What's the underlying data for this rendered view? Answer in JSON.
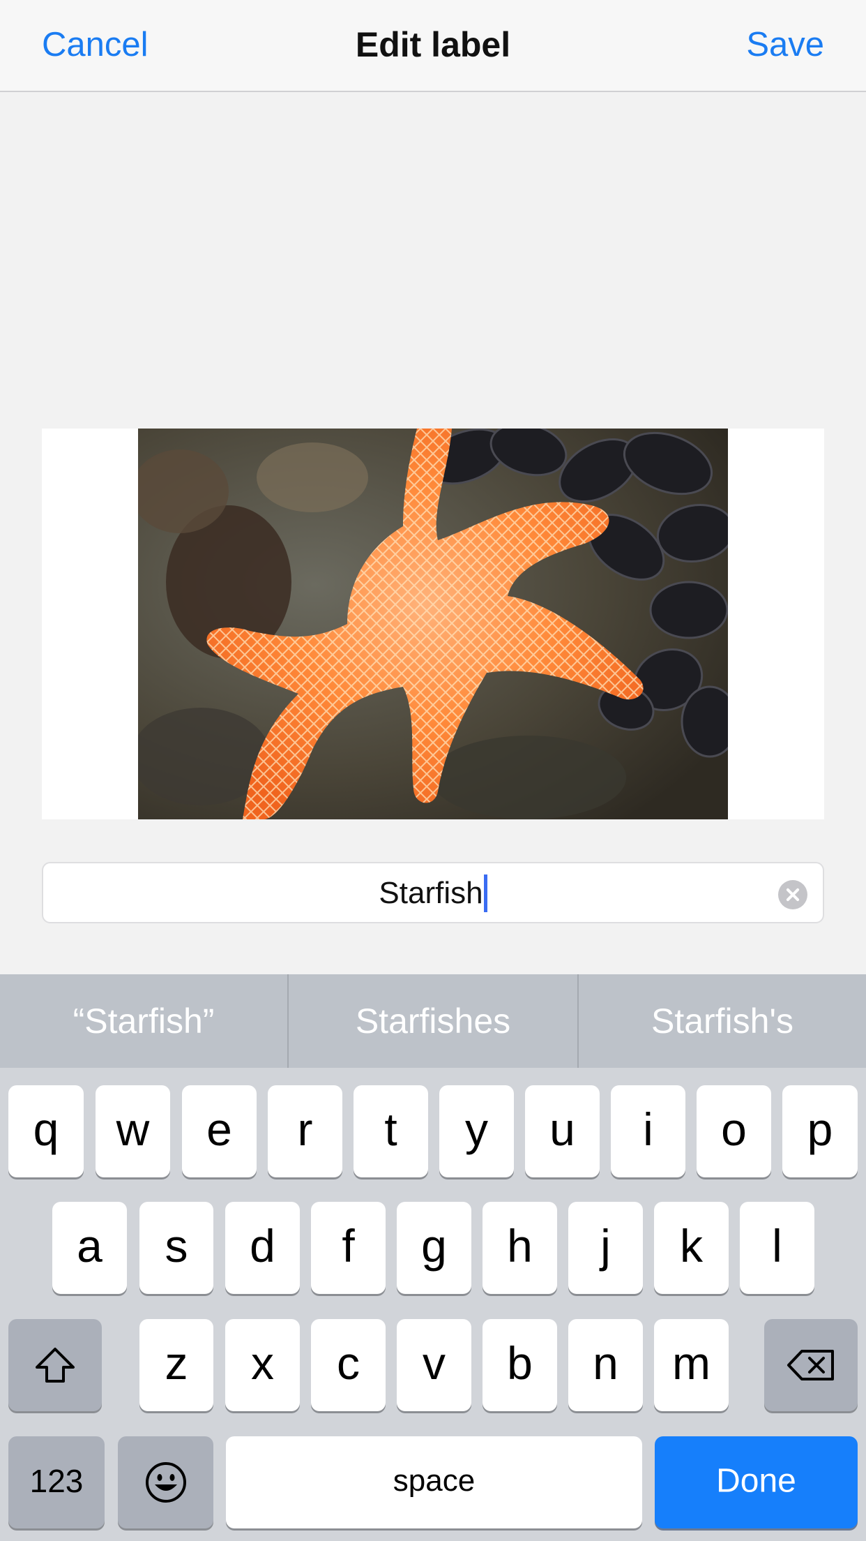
{
  "navbar": {
    "cancel_label": "Cancel",
    "title": "Edit label",
    "save_label": "Save"
  },
  "label_field": {
    "value": "Starfish"
  },
  "suggestions": [
    "“Starfish”",
    "Starfishes",
    "Starfish's"
  ],
  "keyboard": {
    "row1": [
      "q",
      "w",
      "e",
      "r",
      "t",
      "y",
      "u",
      "i",
      "o",
      "p"
    ],
    "row2": [
      "a",
      "s",
      "d",
      "f",
      "g",
      "h",
      "j",
      "k",
      "l"
    ],
    "row3": [
      "z",
      "x",
      "c",
      "v",
      "b",
      "n",
      "m"
    ],
    "numbers_label": "123",
    "space_label": "space",
    "done_label": "Done"
  },
  "colors": {
    "accent": "#1a7cf2",
    "done_key": "#167ffb",
    "keyboard_bg": "#d1d4d9",
    "suggestion_bar": "#bdc2c9"
  },
  "icons": [
    "clear-icon",
    "shift-icon",
    "emoji-icon",
    "backspace-icon"
  ]
}
